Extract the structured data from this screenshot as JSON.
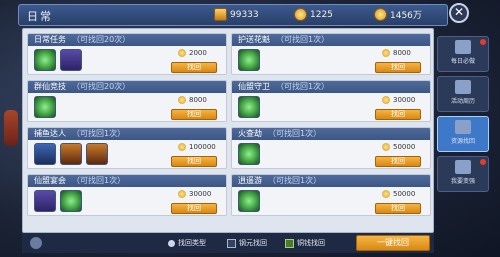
{
  "header": {
    "title": "日常",
    "currencies": [
      {
        "icon": "gold-ingot-icon",
        "value": "99333"
      },
      {
        "icon": "coupon-icon",
        "value": "1225"
      },
      {
        "icon": "coin-icon",
        "value": "1456万"
      }
    ]
  },
  "cards": [
    {
      "name": "日常任务",
      "sub": "（可找回20次）",
      "items": [
        "green",
        "purple"
      ],
      "cost": "2000",
      "btn": "找回"
    },
    {
      "name": "护送花魁",
      "sub": "（可找回1次）",
      "items": [
        "green"
      ],
      "cost": "8000",
      "btn": "找回"
    },
    {
      "name": "群仙竞技",
      "sub": "（可找回20次）",
      "items": [
        "green"
      ],
      "cost": "8000",
      "btn": "找回"
    },
    {
      "name": "仙盟守卫",
      "sub": "（可找回1次）",
      "items": [
        "green"
      ],
      "cost": "30000",
      "btn": "找回"
    },
    {
      "name": "捕鱼达人",
      "sub": "（可找回1次）",
      "items": [
        "blue",
        "orange",
        "orange"
      ],
      "cost": "100000",
      "btn": "找回"
    },
    {
      "name": "火查劫",
      "sub": "（可找回1次）",
      "items": [
        "green"
      ],
      "cost": "50000",
      "btn": "找回"
    },
    {
      "name": "仙盟宴会",
      "sub": "（可找回1次）",
      "items": [
        "purple",
        "green"
      ],
      "cost": "30000",
      "btn": "找回"
    },
    {
      "name": "逍遥游",
      "sub": "（可找回1次）",
      "items": [
        "green"
      ],
      "cost": "50000",
      "btn": "找回"
    }
  ],
  "bottom": {
    "find_type_label": "找回类型",
    "option1": "钢元找回",
    "option2": "铜钱找回",
    "onekey_label": "一键找回"
  },
  "tabs": [
    {
      "label": "每日必做"
    },
    {
      "label": "活动周历"
    },
    {
      "label": "资源找回"
    },
    {
      "label": "我要变强"
    }
  ]
}
